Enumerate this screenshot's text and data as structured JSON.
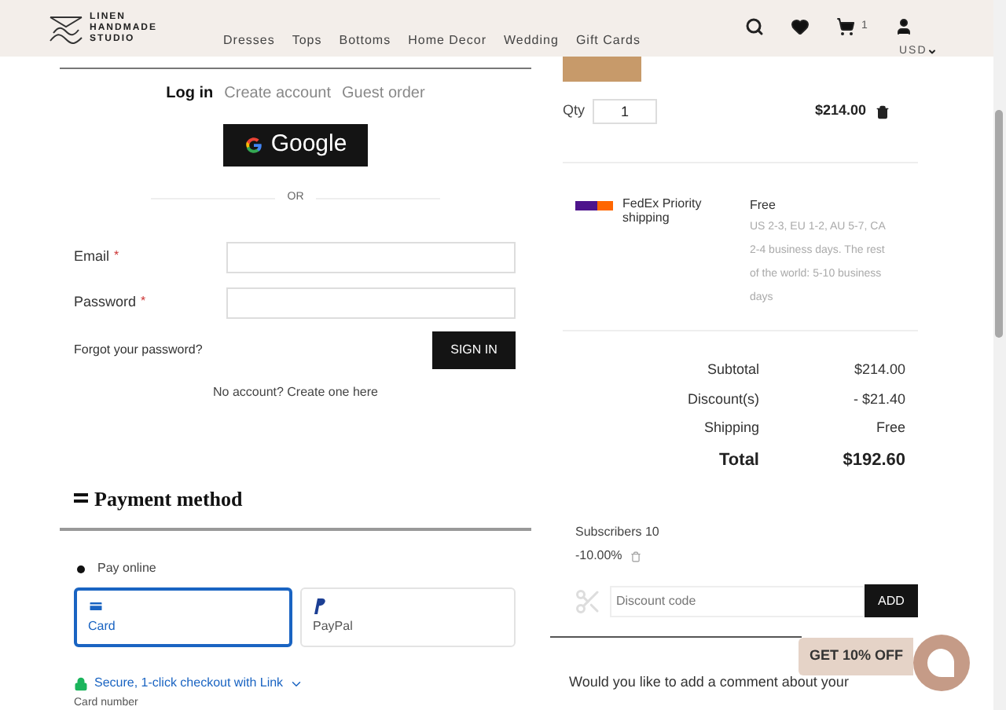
{
  "header": {
    "logo": [
      "LINEN",
      "HANDMADE",
      "STUDIO"
    ],
    "nav": [
      "Dresses",
      "Tops",
      "Bottoms",
      "Home Decor",
      "Wedding",
      "Gift Cards"
    ],
    "cart_count": "1",
    "currency": "USD"
  },
  "login": {
    "tabs": [
      {
        "label": "Log in",
        "selected": true
      },
      {
        "label": "Create account",
        "selected": false
      },
      {
        "label": "Guest order",
        "selected": false
      }
    ],
    "google_button": "Google",
    "divider": "OR",
    "fields": [
      {
        "label": "Email",
        "required_mark": "*"
      },
      {
        "label": "Password",
        "required_mark": "*"
      }
    ],
    "forgot": "Forgot your password?",
    "sign_in": "SIGN IN",
    "no_account": "No account? Create one here"
  },
  "payment": {
    "title": "Payment method",
    "option": "Pay online",
    "methods": [
      {
        "label": "Card",
        "selected": true
      },
      {
        "label": "PayPal",
        "selected": false
      }
    ],
    "link": "Secure, 1-click checkout with Link",
    "card_number": "Card number"
  },
  "cart": {
    "qty_label": "Qty",
    "qty": "1",
    "line_price": "$214.00",
    "shipping": {
      "carrier": "FedEx Priority shipping",
      "price": "Free",
      "note": "US 2-3, EU 1-2, AU 5-7, CA 2-4 business days. The rest of the world: 5-10 business days"
    },
    "totals": [
      {
        "label": "Subtotal",
        "value": "$214.00",
        "bold": false
      },
      {
        "label": "Discount(s)",
        "value": "- $21.40",
        "bold": false
      },
      {
        "label": "Shipping",
        "value": "Free",
        "bold": false
      },
      {
        "label": "Total",
        "value": "$192.60",
        "bold": true
      }
    ],
    "discount_name": "Subscribers 10",
    "discount_amount": "-10.00%",
    "discount_placeholder": "Discount code",
    "add_button": "ADD",
    "comment": "Would you like to add a comment about your"
  },
  "promo": "GET 10% OFF"
}
